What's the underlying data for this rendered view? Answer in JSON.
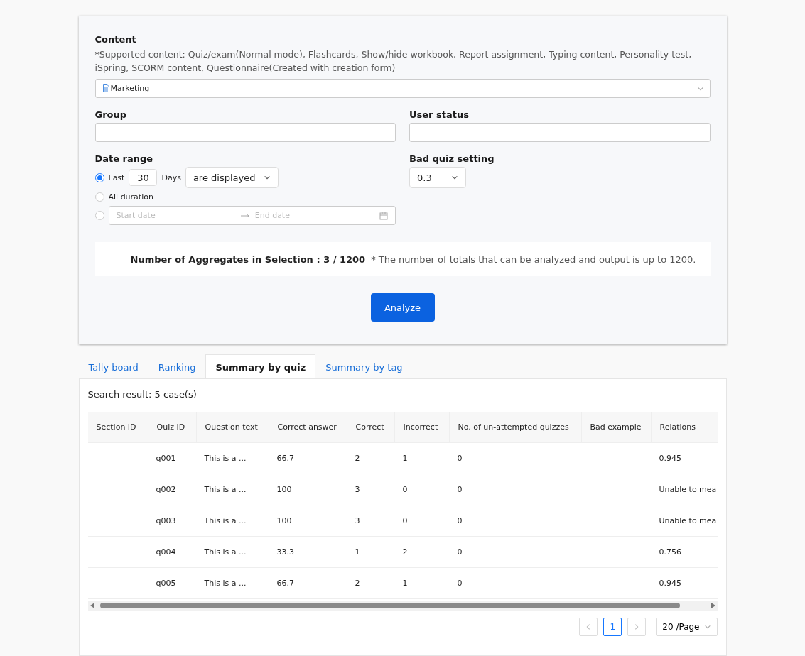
{
  "filter_panel": {
    "content": {
      "label": "Content",
      "note": "*Supported content: Quiz/exam(Normal mode), Flashcards, Show/hide workbook, Report assignment, Typing content, Personality test, iSpring, SCORM content, Questionnaire(Created with creation form)",
      "value": "Marketing"
    },
    "group": {
      "label": "Group"
    },
    "user_status": {
      "label": "User status"
    },
    "date_range": {
      "label": "Date range",
      "options": [
        {
          "kind": "last",
          "selected": true,
          "label": "Last",
          "value": "30",
          "unit": "Days",
          "mode": "are displayed"
        },
        {
          "kind": "all",
          "selected": false,
          "label": "All duration"
        },
        {
          "kind": "range",
          "selected": false,
          "start_placeholder": "Start date",
          "end_placeholder": "End date"
        }
      ]
    },
    "bad_quiz_setting": {
      "label": "Bad quiz setting",
      "value": "0.3"
    },
    "aggregates": {
      "label": "Number of Aggregates in Selection : 3 / 1200",
      "note": "* The number of totals that can be analyzed and output is up to 1200."
    },
    "analyze_button": "Analyze"
  },
  "tabs": [
    {
      "label": "Tally board",
      "selected": false
    },
    {
      "label": "Ranking",
      "selected": false
    },
    {
      "label": "Summary by quiz",
      "selected": true
    },
    {
      "label": "Summary by tag",
      "selected": false
    }
  ],
  "results": {
    "summary": "Search result: 5 case(s)",
    "table": {
      "columns": [
        "Section ID",
        "Quiz ID",
        "Question text",
        "Correct answer",
        "Correct",
        "Incorrect",
        "No. of un-attempted quizzes",
        "Bad example",
        "Relations"
      ],
      "rows": [
        [
          "",
          "q001",
          "This is a ...",
          "66.7",
          "2",
          "1",
          "0",
          "",
          "0.945"
        ],
        [
          "",
          "q002",
          "This is a ...",
          "100",
          "3",
          "0",
          "0",
          "",
          "Unable to mea"
        ],
        [
          "",
          "q003",
          "This is a ...",
          "100",
          "3",
          "0",
          "0",
          "",
          "Unable to mea"
        ],
        [
          "",
          "q004",
          "This is a ...",
          "33.3",
          "1",
          "2",
          "0",
          "",
          "0.756"
        ],
        [
          "",
          "q005",
          "This is a ...",
          "66.7",
          "2",
          "1",
          "0",
          "",
          "0.945"
        ]
      ]
    },
    "pagination": {
      "pages": [
        {
          "label": "1",
          "selected": true
        }
      ],
      "page_size": "20 /Page"
    }
  }
}
